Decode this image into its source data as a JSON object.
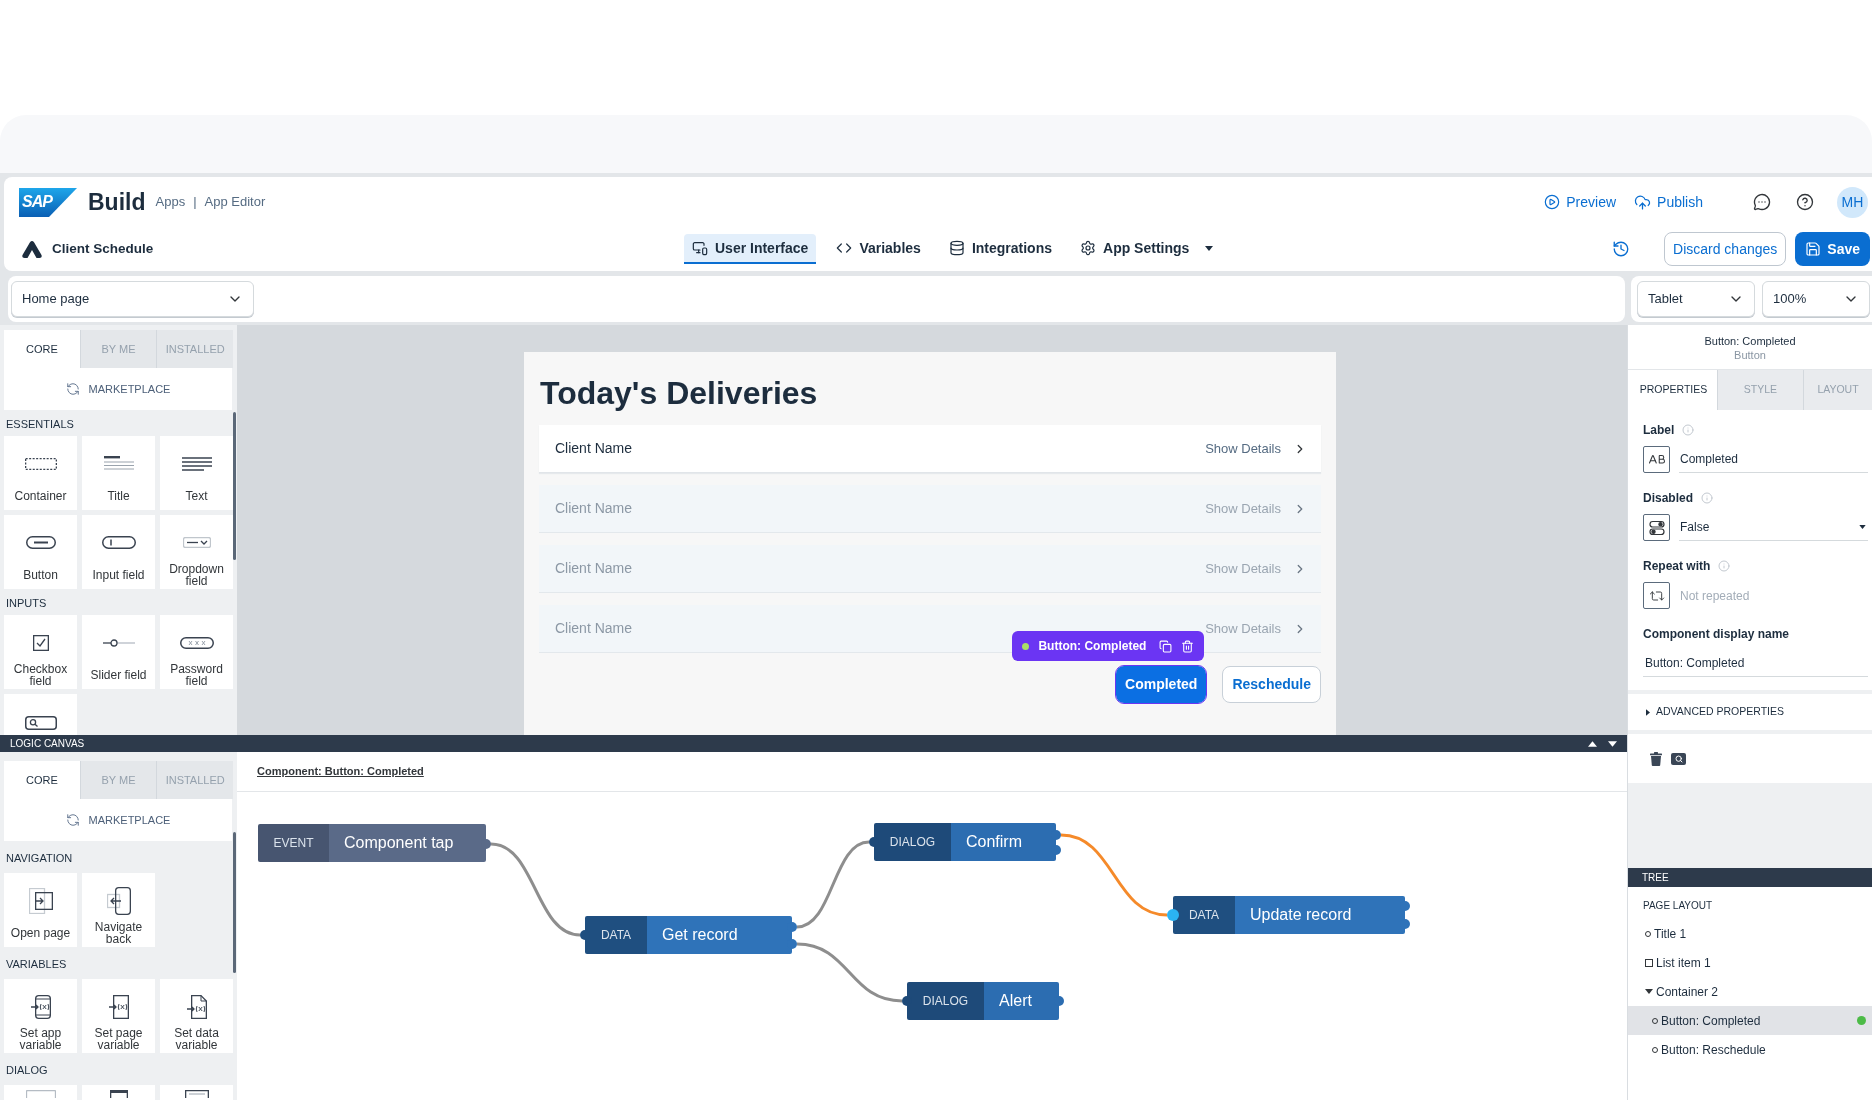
{
  "header": {
    "logo_text": "SAP",
    "product": "Build",
    "breadcrumb": [
      "Apps",
      "App Editor"
    ],
    "separator": "|",
    "actions": [
      {
        "label": "Preview",
        "kind": "preview"
      },
      {
        "label": "Publish",
        "kind": "publish"
      }
    ],
    "avatar": "MH"
  },
  "app_bar": {
    "app_name": "Client Schedule",
    "tabs": [
      {
        "label": "User Interface",
        "kind": "ui",
        "selected": true,
        "has_menu": false
      },
      {
        "label": "Variables",
        "kind": "variables",
        "selected": false,
        "has_menu": false
      },
      {
        "label": "Integrations",
        "kind": "integrations",
        "selected": false,
        "has_menu": false
      },
      {
        "label": "App Settings",
        "kind": "settings",
        "selected": false,
        "has_menu": true
      }
    ],
    "buttons": [
      {
        "label": "Discard changes",
        "kind": "secondary"
      },
      {
        "label": "Save",
        "kind": "primary"
      }
    ]
  },
  "toolbar": {
    "page": "Home page",
    "device": "Tablet",
    "zoom": "100%"
  },
  "component_palette": {
    "tabs": [
      {
        "label": "CORE",
        "selected": true
      },
      {
        "label": "BY ME",
        "selected": false
      },
      {
        "label": "INSTALLED",
        "selected": false
      }
    ],
    "marketplace": "MARKETPLACE",
    "sections": [
      {
        "title": "ESSENTIALS",
        "items": [
          {
            "label": "Container",
            "kind": "container"
          },
          {
            "label": "Title",
            "kind": "title"
          },
          {
            "label": "Text",
            "kind": "text"
          },
          {
            "label": "Button",
            "kind": "button"
          },
          {
            "label": "Input field",
            "kind": "input"
          },
          {
            "label": "Dropdown field",
            "kind": "dropdown"
          }
        ]
      },
      {
        "title": "INPUTS",
        "items": [
          {
            "label": "Checkbox field",
            "kind": "checkbox"
          },
          {
            "label": "Slider field",
            "kind": "slider"
          },
          {
            "label": "Password field",
            "kind": "password"
          },
          {
            "kind": "search"
          }
        ]
      }
    ]
  },
  "canvas": {
    "title": "Today's Deliveries",
    "list_items": [
      {
        "title": "Client Name",
        "action": "Show Details",
        "dimmed": false
      },
      {
        "title": "Client Name",
        "action": "Show Details",
        "dimmed": true
      },
      {
        "title": "Client Name",
        "action": "Show Details",
        "dimmed": true
      },
      {
        "title": "Client Name",
        "action": "Show Details",
        "dimmed": true
      }
    ],
    "selection_toolbar": {
      "label": "Button: Completed"
    },
    "buttons": [
      {
        "label": "Completed",
        "kind": "primary",
        "selected": true
      },
      {
        "label": "Reschedule",
        "kind": "secondary",
        "selected": false
      }
    ]
  },
  "logic_canvas": {
    "title": "LOGIC CANVAS",
    "palette": {
      "tabs": [
        {
          "label": "CORE",
          "selected": true
        },
        {
          "label": "BY ME",
          "selected": false
        },
        {
          "label": "INSTALLED",
          "selected": false
        }
      ],
      "marketplace": "MARKETPLACE",
      "sections": [
        {
          "title": "NAVIGATION",
          "items": [
            {
              "label": "Open page",
              "kind": "open_page"
            },
            {
              "label": "Navigate back",
              "kind": "navigate_back"
            }
          ]
        },
        {
          "title": "VARIABLES",
          "items": [
            {
              "label": "Set app variable",
              "kind": "app_variable"
            },
            {
              "label": "Set page variable",
              "kind": "page_variable"
            },
            {
              "label": "Set data variable",
              "kind": "data_variable"
            }
          ]
        },
        {
          "title": "DIALOG",
          "items": [
            {
              "kind": "dialog_toast"
            },
            {
              "kind": "dialog_alert"
            },
            {
              "kind": "dialog_confirm"
            }
          ]
        }
      ]
    },
    "breadcrumb": "Component: Button: Completed",
    "nodes": [
      {
        "type": "EVENT",
        "label": "Component tap",
        "kind": "event"
      },
      {
        "type": "DATA",
        "label": "Get record",
        "kind": "data"
      },
      {
        "type": "DIALOG",
        "label": "Confirm",
        "kind": "dialog"
      },
      {
        "type": "DATA",
        "label": "Update record",
        "kind": "data"
      },
      {
        "type": "DIALOG",
        "label": "Alert",
        "kind": "dialog"
      }
    ],
    "connections": [
      {
        "highlighted": false
      },
      {
        "highlighted": false
      },
      {
        "highlighted": false
      },
      {
        "highlighted": true
      }
    ]
  },
  "properties_panel": {
    "title": "Button: Completed",
    "subtitle": "Button",
    "tabs": [
      {
        "label": "PROPERTIES",
        "selected": true
      },
      {
        "label": "STYLE",
        "selected": false
      },
      {
        "label": "LAYOUT",
        "selected": false
      }
    ],
    "fields": [
      {
        "label": "Label",
        "kind": "text",
        "value": "Completed"
      },
      {
        "label": "Disabled",
        "kind": "select",
        "value": "False"
      },
      {
        "label": "Repeat with",
        "kind": "binding",
        "placeholder": "Not repeated"
      },
      {
        "label": "Component display name",
        "kind": "plain",
        "value": "Button: Completed"
      }
    ],
    "advanced": {
      "label": "ADVANCED PROPERTIES",
      "expanded": false
    }
  },
  "tree": {
    "title": "TREE",
    "section": "PAGE LAYOUT",
    "items": [
      {
        "label": "Title 1",
        "kind": "component",
        "selected": false
      },
      {
        "label": "List item 1",
        "kind": "list",
        "selected": false
      },
      {
        "label": "Container 2",
        "kind": "container",
        "selected": false,
        "expanded": true,
        "children": [
          {
            "label": "Button: Completed",
            "kind": "component",
            "selected": true
          },
          {
            "label": "Button: Reschedule",
            "kind": "component",
            "selected": false
          }
        ]
      }
    ]
  }
}
